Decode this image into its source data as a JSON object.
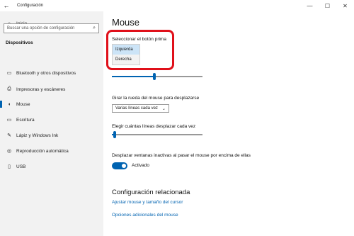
{
  "window": {
    "title": "Configuración",
    "back_icon": "←",
    "minimize_icon": "—",
    "maximize_icon": "☐",
    "close_icon": "✕"
  },
  "sidebar": {
    "home_label": "Inicio",
    "home_icon": "⌂",
    "search_placeholder": "Buscar una opción de configuración",
    "search_icon": "⌕",
    "section_label": "Dispositivos",
    "items": [
      {
        "label": "Bluetooth y otros dispositivos",
        "icon": "▭"
      },
      {
        "label": "Impresoras y escáneres",
        "icon": "⎙"
      },
      {
        "label": "Mouse",
        "icon": "◖"
      },
      {
        "label": "Escritura",
        "icon": "▭"
      },
      {
        "label": "Lápiz y Windows Ink",
        "icon": "✎"
      },
      {
        "label": "Reproducción automática",
        "icon": "◎"
      },
      {
        "label": "USB",
        "icon": "▯"
      }
    ],
    "active_item": "Mouse",
    "accent_color": "#0063b1"
  },
  "main": {
    "title": "Mouse",
    "primary_button": {
      "label": "Seleccionar el botón prima",
      "options": [
        "Izquierda",
        "Derecha"
      ],
      "selected": "Izquierda"
    },
    "cursor_speed_level": 0.47,
    "scroll": {
      "label": "Girar la rueda del mouse para desplazarse",
      "value": "Varias líneas cada vez",
      "chevron": "⌄"
    },
    "lines": {
      "label": "Elegir cuántas líneas desplazar cada vez",
      "level": 0.02
    },
    "inactive_scroll": {
      "label": "Desplazar ventanas inactivas al pasar el mouse por encima de ellas",
      "toggle_state": "Activado",
      "on": true
    },
    "related": {
      "title": "Configuración relacionada",
      "links": [
        "Ajustar mouse y tamaño del cursor",
        "Opciones adicionales del mouse"
      ]
    },
    "highlight_color": "#e0101a"
  }
}
